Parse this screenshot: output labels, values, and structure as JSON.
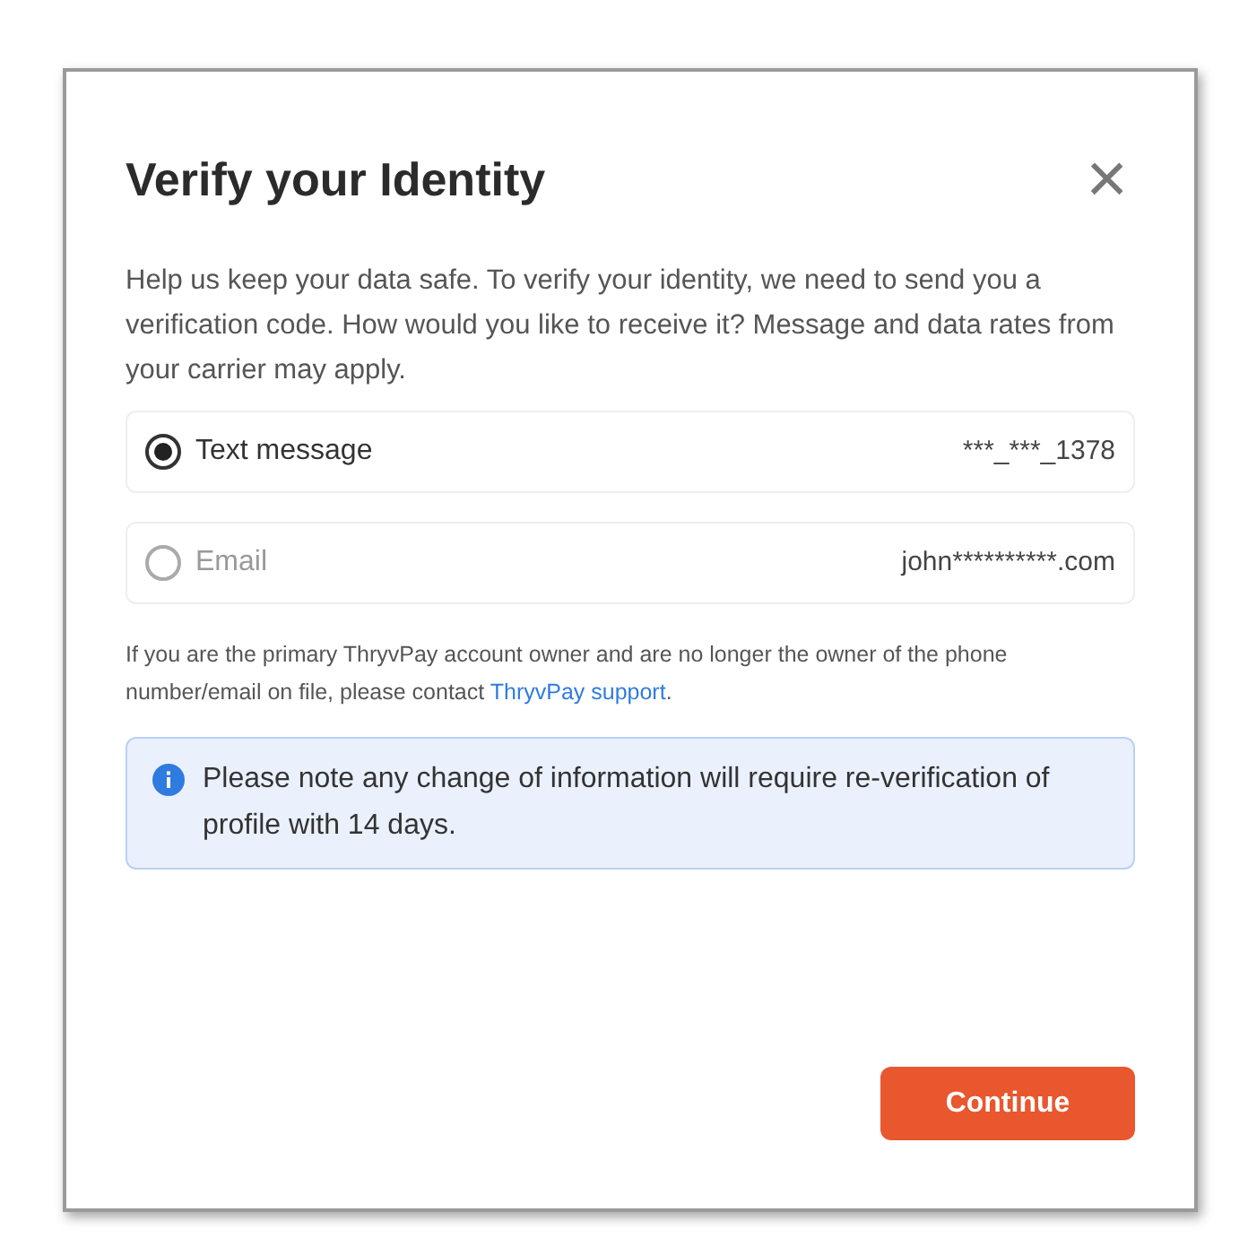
{
  "dialog": {
    "title": "Verify your Identity",
    "close": "×",
    "intro": "Help us keep your data safe. To verify your identity, we need to send you a verification code. How would you like to receive it? Message and data rates from your carrier may apply.",
    "options": [
      {
        "label": "Text message",
        "value": "***_***_1378",
        "selected": true
      },
      {
        "label": "Email",
        "value": "john**********.com",
        "selected": false
      }
    ],
    "note": {
      "text": "If you are the primary ThryvPay account owner and are no longer the owner of the phone number/email on file, please contact ",
      "link": "ThryvPay support",
      "after": "."
    },
    "info": "Please note any change of information will require re-verification of profile with 14 days.",
    "button": "Continue"
  }
}
